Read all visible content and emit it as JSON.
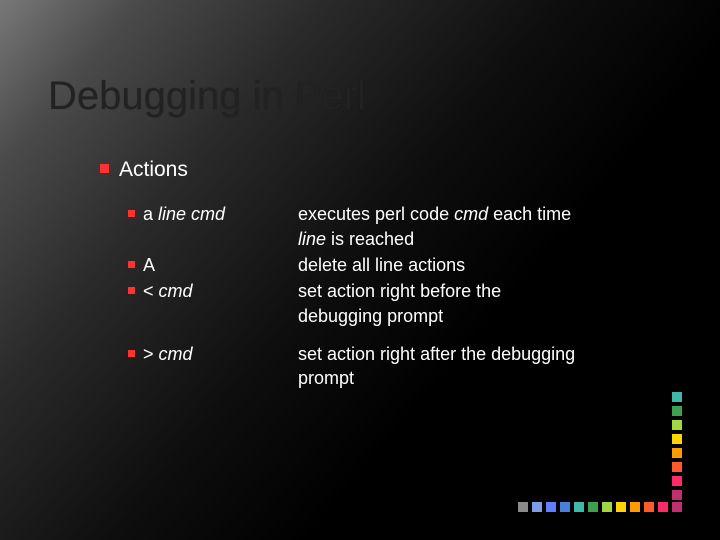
{
  "title": "Debugging in Perl",
  "section_label": "Actions",
  "items": [
    {
      "cmd_prefix": "a ",
      "cmd_italic": "line cmd",
      "desc_plain_1": "executes perl code ",
      "desc_italic_1": "cmd",
      "desc_plain_2": " each time ",
      "desc_italic_2": "line",
      "desc_plain_3": " is reached"
    },
    {
      "cmd_prefix": "A",
      "cmd_italic": "",
      "desc_plain_1": "delete all line actions",
      "desc_italic_1": "",
      "desc_plain_2": "",
      "desc_italic_2": "",
      "desc_plain_3": ""
    },
    {
      "cmd_prefix": "< ",
      "cmd_italic": "cmd",
      "desc_plain_1": "set action right before the debugging prompt",
      "desc_italic_1": "",
      "desc_plain_2": "",
      "desc_italic_2": "",
      "desc_plain_3": ""
    },
    {
      "cmd_prefix": "> ",
      "cmd_italic": "cmd",
      "desc_plain_1": "set action right after the debugging prompt",
      "desc_italic_1": "",
      "desc_plain_2": "",
      "desc_italic_2": "",
      "desc_plain_3": ""
    }
  ],
  "colors_h": [
    "#8a8a8a",
    "#7e9fe8",
    "#5f7fff",
    "#477fd9",
    "#3fb8a8",
    "#3fa04f",
    "#9fd83f",
    "#ffd400",
    "#ff9a00",
    "#ff5a2a",
    "#ff2a6a",
    "#c03070"
  ],
  "colors_v": [
    "#c03070",
    "#ff2a6a",
    "#ff5a2a",
    "#ff9a00",
    "#ffd400",
    "#9fd83f",
    "#3fa04f",
    "#3fb8a8"
  ]
}
